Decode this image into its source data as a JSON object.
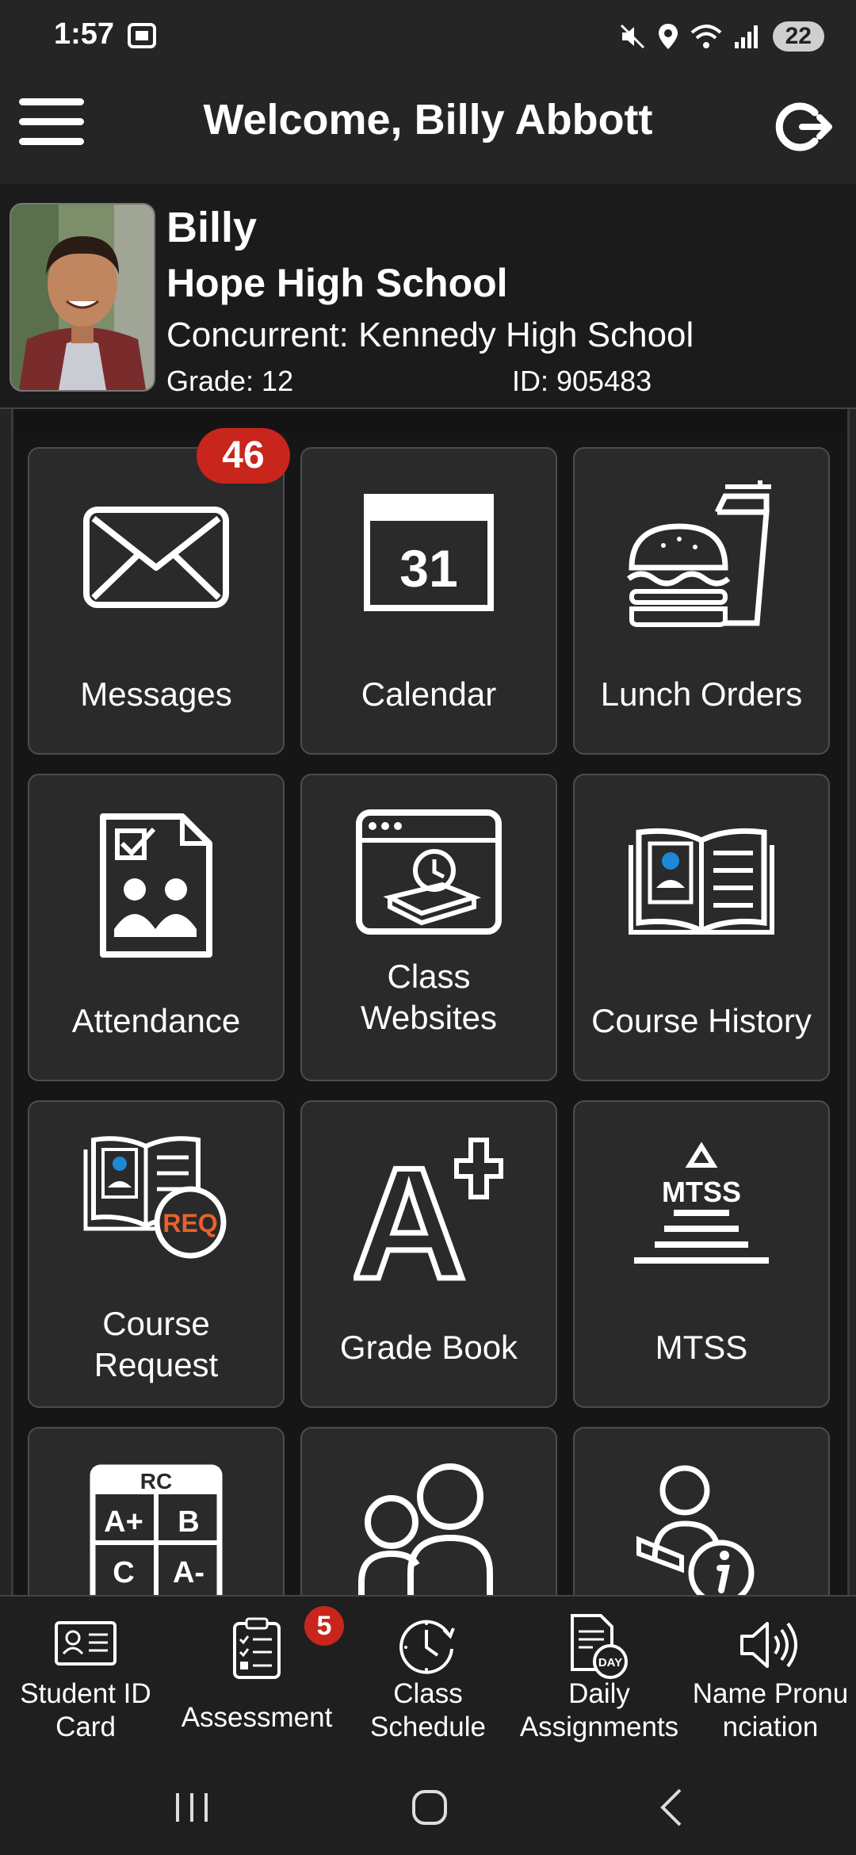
{
  "status_bar": {
    "time": "1:57",
    "battery": "22",
    "icons": [
      "screenshot-icon",
      "mute-icon",
      "location-icon",
      "wifi-icon",
      "signal-icon",
      "battery-icon"
    ]
  },
  "header": {
    "title": "Welcome, Billy Abbott",
    "menu_icon": "hamburger-menu-icon",
    "signout_icon": "sign-out-icon"
  },
  "student": {
    "first_name": "Billy",
    "school": "Hope High School",
    "concurrent": "Concurrent: Kennedy High School",
    "grade": "Grade: 12",
    "id": "ID: 905483"
  },
  "tiles": [
    {
      "label": "Messages",
      "icon": "envelope-icon",
      "badge": "46"
    },
    {
      "label": "Calendar",
      "icon": "calendar-icon",
      "calendar_day": "31"
    },
    {
      "label": "Lunch Orders",
      "icon": "burger-drink-icon"
    },
    {
      "label": "Attendance",
      "icon": "attendance-document-icon"
    },
    {
      "label_line1": "Class",
      "label_line2": "Websites",
      "icon": "browser-book-clock-icon"
    },
    {
      "label": "Course History",
      "icon": "open-book-icon"
    },
    {
      "label_line1": "Course",
      "label_line2": "Request",
      "icon": "book-req-icon",
      "req_text": "REQ"
    },
    {
      "label": "Grade Book",
      "icon": "a-plus-icon",
      "big_letter": "A"
    },
    {
      "label": "MTSS",
      "icon": "pyramid-icon",
      "pyramid_text": "MTSS"
    },
    {
      "label": "",
      "icon": "report-card-icon",
      "rc_header": "RC",
      "rc_cells": [
        "A+",
        "B",
        "C",
        "A-"
      ]
    },
    {
      "label": "",
      "icon": "parents-icon"
    },
    {
      "label": "",
      "icon": "person-info-icon"
    }
  ],
  "bottom_nav": [
    {
      "line1": "Student ID",
      "line2": "Card",
      "icon": "id-card-icon"
    },
    {
      "line1": "Assessment",
      "line2": "",
      "icon": "checklist-icon",
      "badge": "5"
    },
    {
      "line1": "Class",
      "line2": "Schedule",
      "icon": "clock-icon"
    },
    {
      "line1": "Daily",
      "line2": "Assignments",
      "icon": "day-document-icon",
      "day_text": "DAY"
    },
    {
      "line1": "Name Pronu",
      "line2": "nciation",
      "icon": "speaker-icon"
    }
  ],
  "colors": {
    "background": "#252525",
    "tile": "#2a2a2a",
    "badge": "#c8261d",
    "accent_blue": "#1e88d6",
    "accent_orange": "#e8612c"
  }
}
